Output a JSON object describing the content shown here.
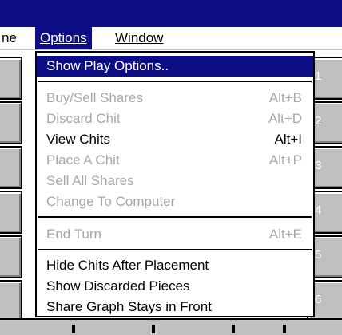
{
  "titlebar": {},
  "menubar": {
    "partial_left": "ne",
    "options": "Options",
    "window": "Window"
  },
  "dropdown": {
    "show_play_options": "Show Play Options..",
    "buy_sell_shares": "Buy/Sell Shares",
    "buy_sell_shares_accel": "Alt+B",
    "discard_chit": "Discard Chit",
    "discard_chit_accel": "Alt+D",
    "view_chits": "View Chits",
    "view_chits_accel": "Alt+I",
    "place_a_chit": "Place A Chit",
    "place_a_chit_accel": "Alt+P",
    "sell_all_shares": "Sell All Shares",
    "change_to_computer": "Change To Computer",
    "end_turn": "End Turn",
    "end_turn_accel": "Alt+E",
    "hide_chits": "Hide Chits After Placement",
    "show_discarded": "Show Discarded Pieces",
    "share_graph": "Share Graph Stays in Front"
  },
  "board": {
    "rows": [
      "1",
      "2",
      "3",
      "4",
      "5",
      "6"
    ]
  },
  "colors": {
    "selection": "#0c0c84",
    "disabled_text": "#a8a8a8",
    "slot": "#c0c0c0"
  }
}
